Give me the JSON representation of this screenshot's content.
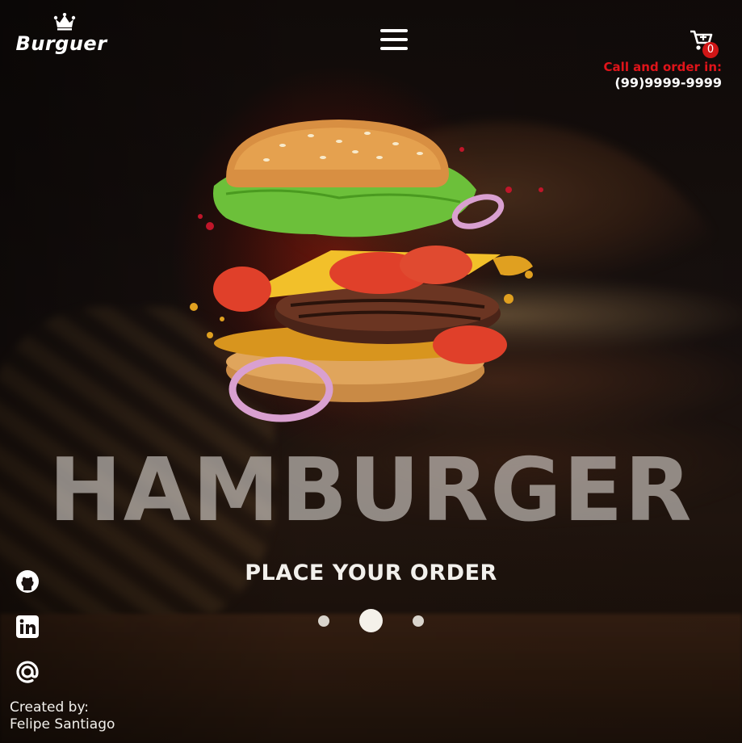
{
  "header": {
    "brand": "Burguer",
    "cart_count": "0",
    "call_label": "Call and order in:",
    "phone": "(99)9999-9999"
  },
  "hero": {
    "title": "HAMBURGER",
    "cta": "PLACE YOUR ORDER",
    "slides": 3,
    "active_slide": 2
  },
  "social": [
    "github-icon",
    "linkedin-icon",
    "at-sign-icon"
  ],
  "footer": {
    "credit_label": "Created by:",
    "credit_name": "Felipe Santiago"
  },
  "colors": {
    "accent": "#e0141a",
    "badge": "#d01616",
    "text": "#ffffff"
  }
}
